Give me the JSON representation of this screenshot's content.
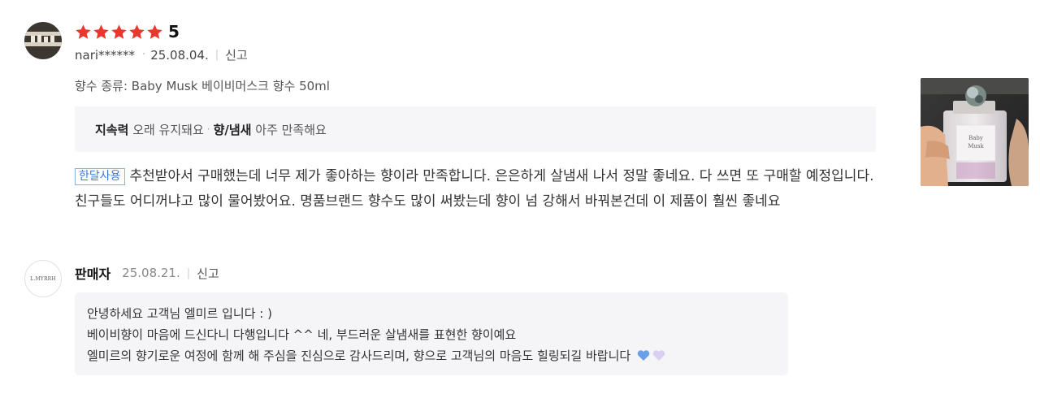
{
  "review": {
    "avatar_icon": "user-avatar-bookshelf",
    "rating_value": "5",
    "star_count": 5,
    "star_color": "#e8372c",
    "user": "nari******",
    "date": "25.08.04.",
    "report_label": "신고",
    "option": "향수 종류: Baby Musk 베이비머스크 향수 50ml",
    "attributes": [
      {
        "name": "지속력",
        "value": "오래 유지돼요"
      },
      {
        "name": "향/냄새",
        "value": "아주 만족해요"
      }
    ],
    "tag": "한달사용",
    "text": "추천받아서 구매했는데 너무 제가 좋아하는 향이라 만족합니다. 은은하게 살냄새 나서 정말 좋네요. 다 쓰면 또 구매할 예정입니다. 친구들도 어디꺼냐고 많이 물어봤어요. 명품브랜드 향수도 많이 써봤는데 향이 넘 강해서 바꿔본건데 이 제품이 훨씬 좋네요",
    "photo": {
      "label_line1": "Baby",
      "label_line2": "Musk"
    }
  },
  "seller": {
    "logo_text": "L.MYRRH",
    "name": "판매자",
    "date": "25.08.21.",
    "report_label": "신고",
    "reply_lines": [
      "안녕하세요 고객님  엘미르 입니다 : )",
      "베이비향이 마음에 드신다니 다행입니다 ^^ 네, 부드러운 살냄새를 표현한 향이예요",
      "엘미르의 향기로운 여정에 함께 해 주심을 진심으로 감사드리며, 향으로 고객님의 마음도 힐링되길 바랍니다"
    ],
    "heart_colors": [
      "#6aa0e6",
      "#d9cff0"
    ]
  }
}
